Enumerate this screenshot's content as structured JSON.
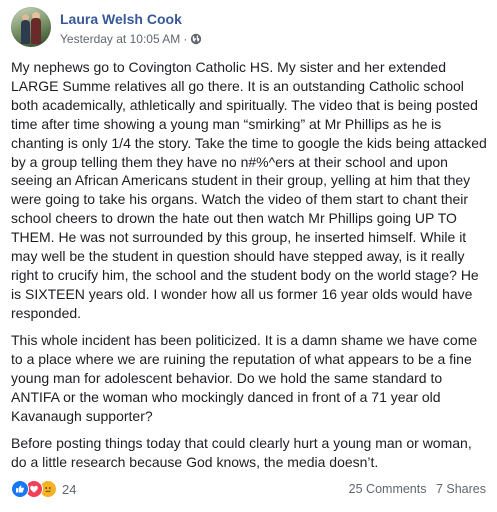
{
  "post": {
    "author": "Laura Welsh Cook",
    "timestamp": "Yesterday at 10:05 AM",
    "separator": "·",
    "paragraphs": [
      "My nephews go to Covington Catholic HS. My sister and her extended LARGE Summe relatives all go there. It is an outstanding Catholic school both academically, athletically and spiritually. The video that is being posted time after time showing a young man “smirking” at Mr Phillips as he is chanting is only 1/4 the story. Take the time to google the kids being attacked by a group telling them they have no n#%^ers at their school and upon seeing an African Americans student in their group, yelling at him that they were going to take his organs. Watch the video of them start to chant their school cheers to drown the hate out then watch Mr Phillips going UP TO THEM. He was not surrounded by this group, he inserted himself. While it may well be the student in question should have stepped away, is it really right to crucify him, the school and the student body on the world stage? He is SIXTEEN years old. I wonder how all us former 16 year olds would have responded.",
      "This whole incident has been politicized. It is a damn shame we have come to a place where we are ruining the reputation of what appears to be a fine young man for adolescent behavior. Do we hold the same standard to ANTIFA or the woman who mockingly danced in front of a 71 year old Kavanaugh supporter?",
      "Before posting things today that could clearly hurt a young man or woman, do a little research because God knows, the media doesn’t."
    ]
  },
  "footer": {
    "reaction_icons": [
      "like-icon",
      "love-icon",
      "sad-icon"
    ],
    "reaction_count": "24",
    "comments": "25 Comments",
    "shares": "7 Shares"
  },
  "colors": {
    "author_link": "#385898",
    "like": "#1877f2",
    "love": "#f33e58",
    "sad": "#f7b125",
    "meta_gray": "#616770"
  }
}
